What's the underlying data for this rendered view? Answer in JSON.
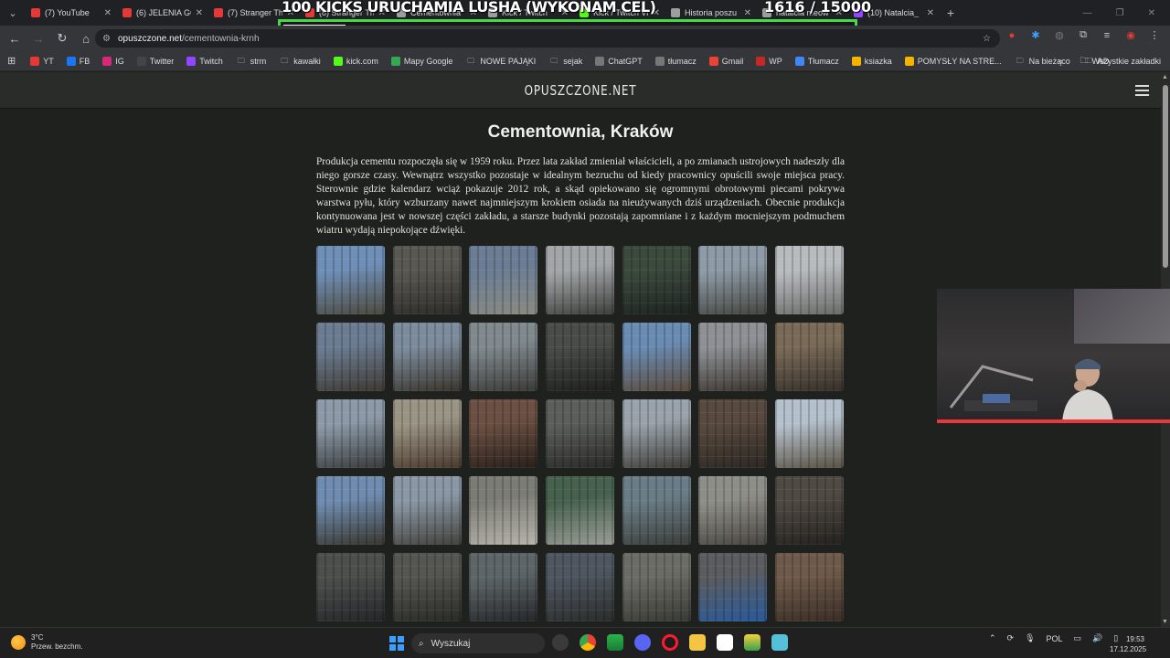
{
  "overlay": {
    "kicks_goal": "100 KICKS URUCHAMIA LUSHA (WYKONAM CEL)",
    "counter": "1616 / 15000",
    "progress": 0.1077
  },
  "tabs": [
    {
      "title": "(7) YouTube",
      "color": "#e53935"
    },
    {
      "title": "(6) JELENIA GÓ",
      "color": "#e53935"
    },
    {
      "title": "(7) Stranger Th",
      "color": "#e53935"
    },
    {
      "title": "(8) Stranger Th",
      "color": "#e53935"
    },
    {
      "title": "Cementownia",
      "color": "#9e9e9e"
    },
    {
      "title": "Kick / Twitch",
      "color": "#9e9e9e"
    },
    {
      "title": "Kick / Twitch Vi",
      "color": "#53fc18"
    },
    {
      "title": "Historia poszu",
      "color": "#9e9e9e"
    },
    {
      "title": "natalcia meow",
      "color": "#9e9e9e"
    },
    {
      "title": "(10) Natalcia_",
      "color": "#9146ff"
    }
  ],
  "address": {
    "host": "opuszczone.net",
    "path": "/cementownia-krnh"
  },
  "bookmarks": [
    {
      "label": "YT",
      "icon": "youtube-icon",
      "color": "#e53935"
    },
    {
      "label": "FB",
      "icon": "facebook-icon",
      "color": "#1877f2"
    },
    {
      "label": "IG",
      "icon": "instagram-icon",
      "color": "#d62976"
    },
    {
      "label": "Twitter",
      "icon": "x-icon",
      "color": "#444"
    },
    {
      "label": "Twitch",
      "icon": "twitch-icon",
      "color": "#9146ff"
    },
    {
      "label": "strm",
      "icon": "folder-icon",
      "color": ""
    },
    {
      "label": "kawałki",
      "icon": "folder-icon",
      "color": ""
    },
    {
      "label": "kick.com",
      "icon": "kick-icon",
      "color": "#53fc18"
    },
    {
      "label": "Mapy Google",
      "icon": "maps-icon",
      "color": "#34a853"
    },
    {
      "label": "NOWE PAJĄKI",
      "icon": "folder-icon",
      "color": ""
    },
    {
      "label": "sejak",
      "icon": "folder-icon",
      "color": ""
    },
    {
      "label": "ChatGPT",
      "icon": "chatgpt-icon",
      "color": "#777"
    },
    {
      "label": "tłumacz",
      "icon": "chatgpt-icon",
      "color": "#777"
    },
    {
      "label": "Gmail",
      "icon": "gmail-icon",
      "color": "#ea4335"
    },
    {
      "label": "WP",
      "icon": "wp-icon",
      "color": "#c62828"
    },
    {
      "label": "Tłumacz",
      "icon": "translate-icon",
      "color": "#4285f4"
    },
    {
      "label": "ksiazka",
      "icon": "windows-icon",
      "color": "#f4b400"
    },
    {
      "label": "POMYSŁY NA STRE...",
      "icon": "windows-icon",
      "color": "#f4b400"
    },
    {
      "label": "Na bieżąco",
      "icon": "folder-icon",
      "color": ""
    },
    {
      "label": "AD",
      "icon": "folder-icon",
      "color": ""
    }
  ],
  "bookmarks_all": "Wszystkie zakładki",
  "site": {
    "logo": "OPUSZCZONE.NET"
  },
  "article": {
    "title": "Cementownia, Kraków",
    "description": "Produkcja cementu rozpoczęła się w 1959 roku. Przez lata zakład zmieniał właścicieli, a po zmianach ustrojowych nadeszły dla niego gorsze czasy. Wewnątrz wszystko pozostaje w idealnym bezruchu od kiedy pracownicy opuścili swoje miejsca pracy. Sterownie gdzie kalendarz wciąż pokazuje 2012 rok, a skąd opiekowano się ogromnymi obrotowymi piecami pokrywa warstwa pyłu, który wzburzany nawet najmniejszym krokiem osiada na nieużywanych dziś urządzeniach. Obecnie produkcja kontynuowana jest w nowszej części zakładu, a starsze budynki pozostają zapomniane i z każdym mocniejszym podmuchem wiatru wydają niepokojące dźwięki."
  },
  "gallery": [
    {
      "c1": "#6f8fb8",
      "c2": "#4d4a3e"
    },
    {
      "c1": "#5a5852",
      "c2": "#2e2c28"
    },
    {
      "c1": "#6a7d95",
      "c2": "#8a8a80"
    },
    {
      "c1": "#a2a6a8",
      "c2": "#3e3f3c"
    },
    {
      "c1": "#3c4a3e",
      "c2": "#1e2420"
    },
    {
      "c1": "#8e9aa6",
      "c2": "#444640"
    },
    {
      "c1": "#b8bcbf",
      "c2": "#6a6a68"
    },
    {
      "c1": "#6b7c92",
      "c2": "#3f3a33"
    },
    {
      "c1": "#7d8c9c",
      "c2": "#3a352d"
    },
    {
      "c1": "#80898e",
      "c2": "#3b3a37"
    },
    {
      "c1": "#4a4c48",
      "c2": "#1f201e"
    },
    {
      "c1": "#6a8cb3",
      "c2": "#5b4a3c"
    },
    {
      "c1": "#8d9094",
      "c2": "#3a342e"
    },
    {
      "c1": "#7a6a58",
      "c2": "#35302a"
    },
    {
      "c1": "#8c9aa8",
      "c2": "#3a3d3e"
    },
    {
      "c1": "#9a9484",
      "c2": "#4a3a2e"
    },
    {
      "c1": "#6b5043",
      "c2": "#2a211c"
    },
    {
      "c1": "#5c5e5a",
      "c2": "#2a2a28"
    },
    {
      "c1": "#9aa3ab",
      "c2": "#3e3c38"
    },
    {
      "c1": "#584a3e",
      "c2": "#2e2824"
    },
    {
      "c1": "#b4c0cc",
      "c2": "#5a5244"
    },
    {
      "c1": "#6f8cb0",
      "c2": "#3a3830"
    },
    {
      "c1": "#8a98a6",
      "c2": "#44423c"
    },
    {
      "c1": "#7c7c76",
      "c2": "#b6b4ab"
    },
    {
      "c1": "#46614e",
      "c2": "#9a9c96"
    },
    {
      "c1": "#6a7d86",
      "c2": "#3d3f3c"
    },
    {
      "c1": "#8e8e88",
      "c2": "#4a4742"
    },
    {
      "c1": "#504a44",
      "c2": "#25221f"
    },
    {
      "c1": "#4d4f4c",
      "c2": "#26262a"
    },
    {
      "c1": "#555651",
      "c2": "#2a2a27"
    },
    {
      "c1": "#5e6568",
      "c2": "#25282a"
    },
    {
      "c1": "#4f5660",
      "c2": "#2b2d2c"
    },
    {
      "c1": "#6b6c66",
      "c2": "#3a3a34"
    },
    {
      "c1": "#5a5c60",
      "c2": "#2a5a9a"
    },
    {
      "c1": "#6e5a4a",
      "c2": "#3a2e26"
    }
  ],
  "taskbar": {
    "temp": "3°C",
    "weather_desc": "Przew. bezchm.",
    "search_placeholder": "Wyszukaj",
    "lang": "POL",
    "time": "19:53",
    "date": "17.12.2025"
  }
}
